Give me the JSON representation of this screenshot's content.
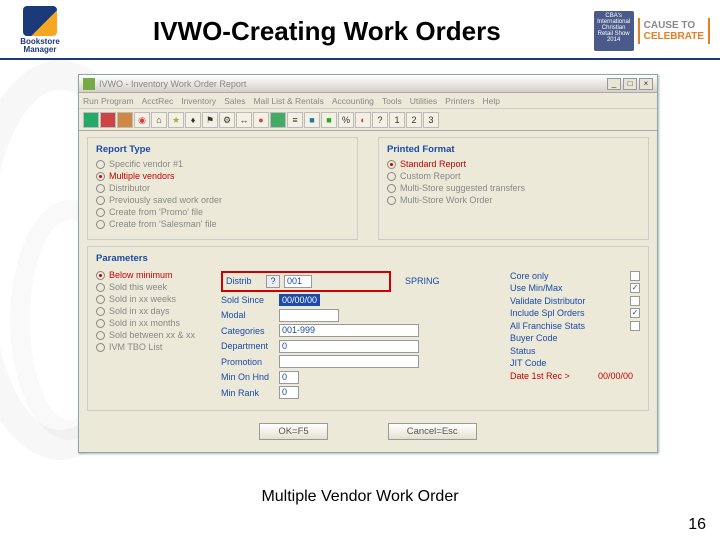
{
  "slide": {
    "title": "IVWO-Creating Work Orders",
    "caption": "Multiple Vendor Work Order",
    "page": "16",
    "logo_left_line1": "Bookstore",
    "logo_left_line2": "Manager",
    "cba": "CBA's International Christian Retail Show 2014",
    "cause1": "CAUSE TO",
    "cause2": "CELEBRATE"
  },
  "window": {
    "title": "IVWO - Inventory Work Order Report",
    "menus": [
      "Run Program",
      "AcctRec",
      "Inventory",
      "Sales",
      "Mail List & Rentals",
      "Accounting",
      "Tools",
      "Utilities",
      "Printers",
      "Help"
    ],
    "toolbar_nums": [
      "1",
      "2",
      "3"
    ]
  },
  "report_type": {
    "title": "Report Type",
    "options": [
      {
        "label": "Specific vendor #1",
        "on": false
      },
      {
        "label": "Multiple vendors",
        "on": true
      },
      {
        "label": "Distributor",
        "on": false
      },
      {
        "label": "Previously saved work order",
        "on": false
      },
      {
        "label": "Create from 'Promo' file",
        "on": false
      },
      {
        "label": "Create from 'Salesman' file",
        "on": false
      }
    ]
  },
  "printed_format": {
    "title": "Printed Format",
    "options": [
      {
        "label": "Standard Report",
        "on": true
      },
      {
        "label": "Custom Report",
        "on": false
      },
      {
        "label": "Multi-Store suggested transfers",
        "on": false
      },
      {
        "label": "Multi-Store Work Order",
        "on": false
      }
    ]
  },
  "parameters": {
    "title": "Parameters",
    "left": [
      {
        "label": "Below minimum",
        "on": true
      },
      {
        "label": "Sold this week",
        "on": false
      },
      {
        "label": "Sold in xx weeks",
        "on": false
      },
      {
        "label": "Sold in xx days",
        "on": false
      },
      {
        "label": "Sold in xx months",
        "on": false
      },
      {
        "label": "Sold between xx & xx",
        "on": false
      },
      {
        "label": "IVM TBO List",
        "on": false
      }
    ],
    "distrib_label": "Distrib",
    "distrib_q": "?",
    "distrib_val": "001",
    "spring_label": "SPRING",
    "sold_since_label": "Sold Since",
    "sold_since_val": "00/00/00",
    "modal_label": "Modal",
    "categories_label": "Categories",
    "categories_val": "001-999",
    "department_label": "Department",
    "department_val": "0",
    "promotion_label": "Promotion",
    "min_onhnd_label": "Min On Hnd",
    "min_onhnd_val": "0",
    "min_rank_label": "Min Rank",
    "min_rank_val": "0",
    "right": [
      {
        "label": "Core only",
        "checked": false
      },
      {
        "label": "Use Min/Max",
        "checked": true
      },
      {
        "label": "Validate Distributor",
        "checked": false
      },
      {
        "label": "Include Spl Orders",
        "checked": true
      },
      {
        "label": "All Franchise Stats",
        "checked": false
      }
    ],
    "buyer_code_label": "Buyer Code",
    "status_label": "Status",
    "jit_code_label": "JIT Code",
    "date_1st_rec_label": "Date 1st Rec >",
    "date_1st_rec_val": "00/00/00"
  },
  "buttons": {
    "ok": "OK=F5",
    "cancel": "Cancel=Esc"
  }
}
